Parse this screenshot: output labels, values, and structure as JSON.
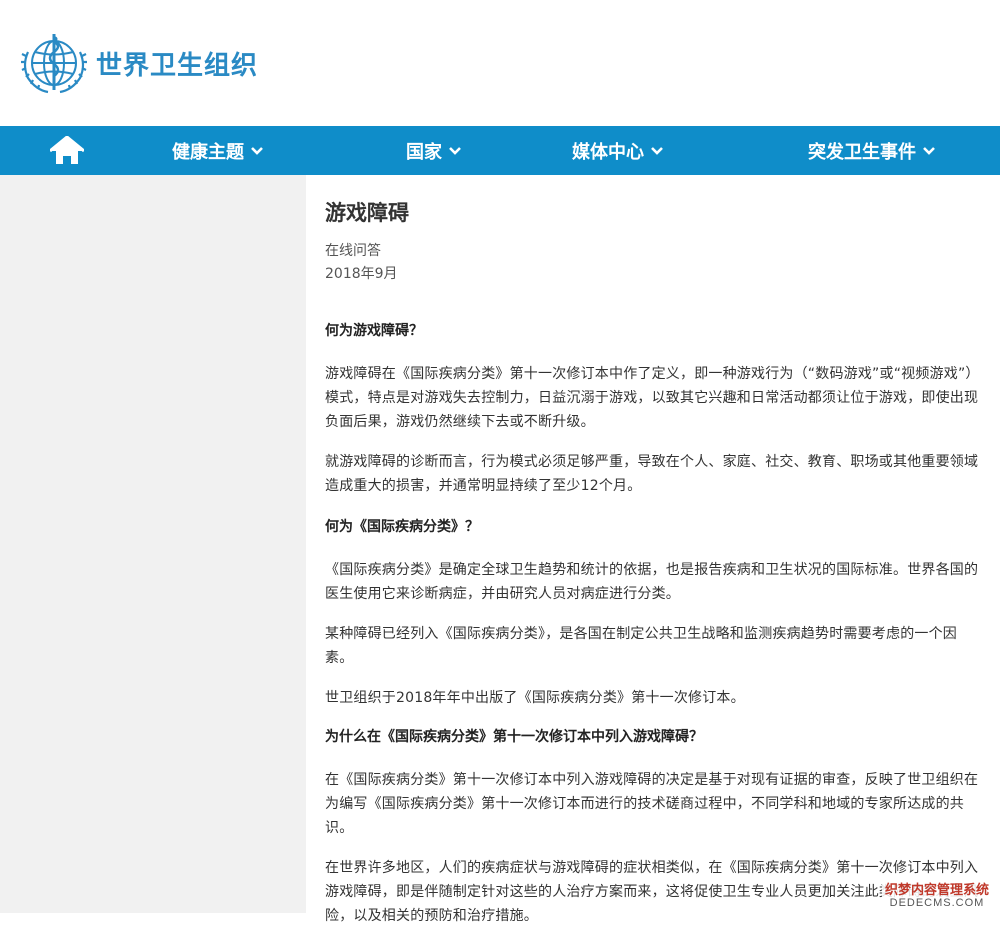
{
  "header": {
    "org_name": "世界卫生组织",
    "logo_icon": "who-emblem-icon"
  },
  "nav": {
    "home_icon": "home-icon",
    "items": [
      {
        "label": "健康主题"
      },
      {
        "label": "国家"
      },
      {
        "label": "媒体中心"
      },
      {
        "label": "突发卫生事件"
      }
    ],
    "background_color": "#0f8dc9",
    "text_color": "#ffffff"
  },
  "article": {
    "title": "游戏障碍",
    "type": "在线问答",
    "date": "2018年9月",
    "sections": [
      {
        "question": "何为游戏障碍？",
        "paragraphs": [
          "游戏障碍在《国际疾病分类》第十一次修订本中作了定义，即一种游戏行为（“数码游戏”或“视频游戏”）模式，特点是对游戏失去控制力，日益沉溺于游戏，以致其它兴趣和日常活动都须让位于游戏，即使出现负面后果，游戏仍然继续下去或不断升级。",
          "就游戏障碍的诊断而言，行为模式必须足够严重，导致在个人、家庭、社交、教育、职场或其他重要领域造成重大的损害，并通常明显持续了至少12个月。"
        ]
      },
      {
        "question": "何为《国际疾病分类》？",
        "paragraphs": [
          "《国际疾病分类》是确定全球卫生趋势和统计的依据，也是报告疾病和卫生状况的国际标准。世界各国的医生使用它来诊断病症，并由研究人员对病症进行分类。",
          "某种障碍已经列入《国际疾病分类》，是各国在制定公共卫生战略和监测疾病趋势时需要考虑的一个因素。",
          "世卫组织于2018年年中出版了《国际疾病分类》第十一次修订本。"
        ]
      },
      {
        "question": "为什么在《国际疾病分类》第十一次修订本中列入游戏障碍？",
        "paragraphs": [
          "在《国际疾病分类》第十一次修订本中列入游戏障碍的决定是基于对现有证据的审查，反映了世卫组织在为编写《国际疾病分类》第十一次修订本而进行的技术磋商过程中，不同学科和地域的专家所达成的共识。",
          "在世界许多地区，人们的疾病症状与游戏障碍的症状相类似，在《国际疾病分类》第十一次修订本中列入游戏障碍，即是伴随制定针对这些的人治疗方案而来，这将促使卫生专业人员更加关注此类障碍的发生风险，以及相关的预防和治疗措施。"
        ]
      }
    ]
  },
  "watermark": {
    "line1": "织梦内容管理系统",
    "line2": "DEDECMS.COM"
  }
}
